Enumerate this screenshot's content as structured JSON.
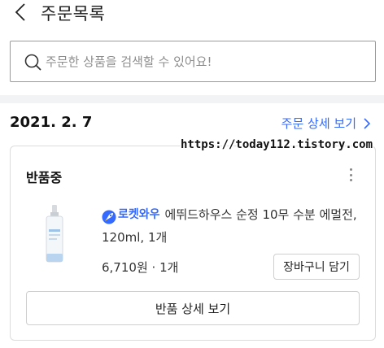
{
  "header": {
    "title": "주문목록",
    "back_icon": "chevron-left-icon"
  },
  "search": {
    "placeholder": "주문한 상품을 검색할 수 있어요!",
    "icon": "search-icon"
  },
  "order": {
    "date": "2021. 2. 7",
    "detail_link": "주문 상세 보기",
    "status": "반품중",
    "product": {
      "badge": "로켓와우",
      "name": "에뛰드하우스 순정 10무 수분 에멀전, 120ml, 1개",
      "price": "6,710원",
      "separator": "·",
      "quantity": "1개"
    },
    "add_to_cart_label": "장바구니 담기",
    "return_detail_label": "반품 상세 보기"
  },
  "watermark": "https://today112.tistory.com",
  "colors": {
    "accent": "#346aff",
    "page_background": "#f2f3f5"
  }
}
